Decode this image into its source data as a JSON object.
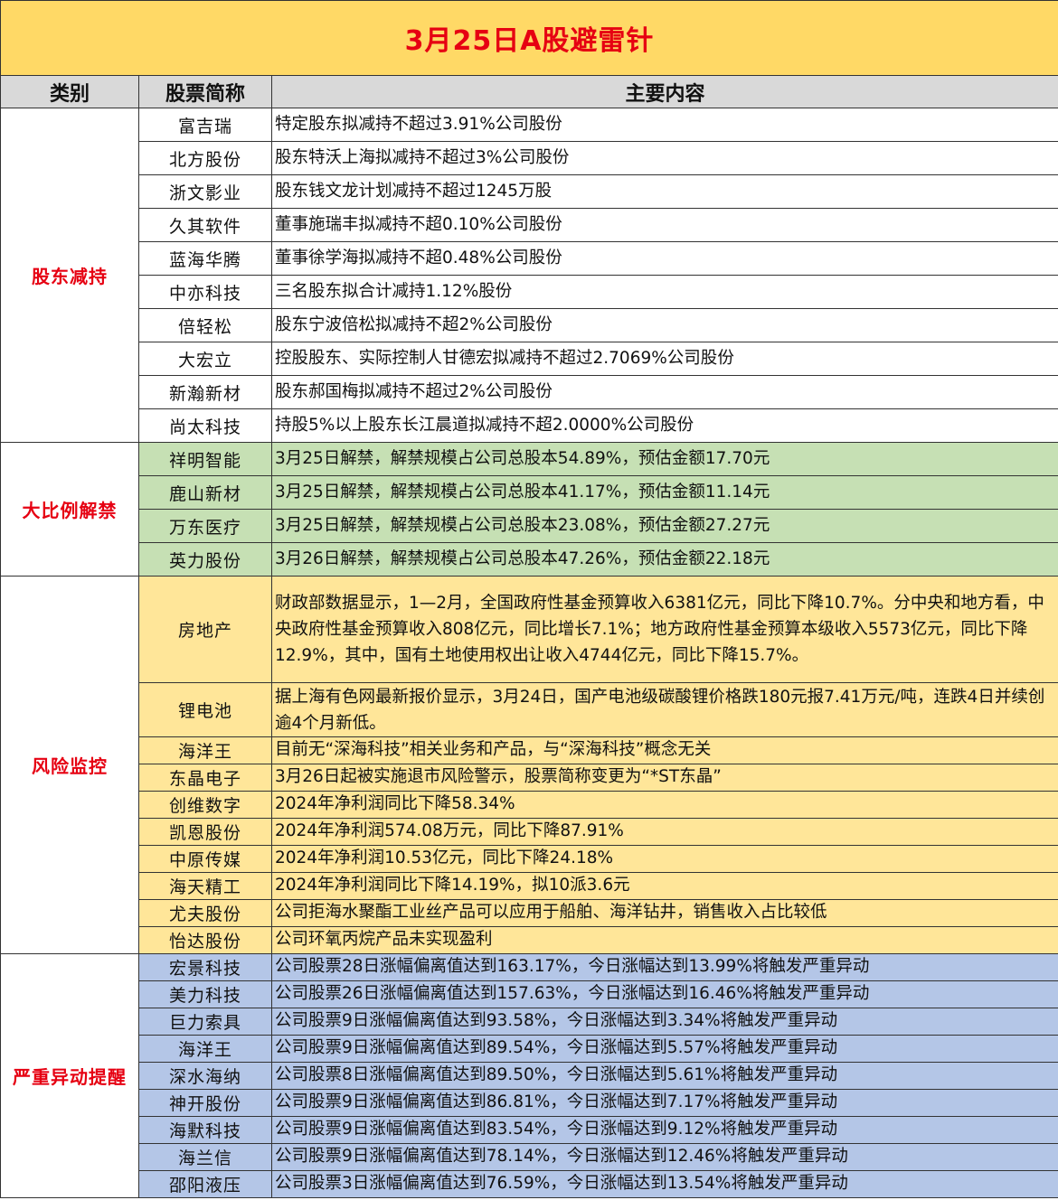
{
  "title": "3月25日A股避雷针",
  "headers": {
    "category": "类别",
    "stock": "股票简称",
    "content": "主要内容"
  },
  "groups": [
    {
      "category": "股东减持",
      "rows": [
        {
          "stock": "富吉瑞",
          "content": "特定股东拟减持不超过3.91%公司股份"
        },
        {
          "stock": "北方股份",
          "content": "股东特沃上海拟减持不超过3%公司股份"
        },
        {
          "stock": "浙文影业",
          "content": "股东钱文龙计划减持不超过1245万股"
        },
        {
          "stock": "久其软件",
          "content": "董事施瑞丰拟减持不超0.10%公司股份"
        },
        {
          "stock": "蓝海华腾",
          "content": "董事徐学海拟减持不超0.48%公司股份"
        },
        {
          "stock": "中亦科技",
          "content": "三名股东拟合计减持1.12%股份"
        },
        {
          "stock": "倍轻松",
          "content": "股东宁波倍松拟减持不超2%公司股份"
        },
        {
          "stock": "大宏立",
          "content": "控股股东、实际控制人甘德宏拟减持不超过2.7069%公司股份"
        },
        {
          "stock": "新瀚新材",
          "content": "股东郝国梅拟减持不超过2%公司股份"
        },
        {
          "stock": "尚太科技",
          "content": "持股5%以上股东长江晨道拟减持不超2.0000%公司股份"
        }
      ]
    },
    {
      "category": "大比例解禁",
      "rows": [
        {
          "stock": "祥明智能",
          "content": "3月25日解禁，解禁规模占公司总股本54.89%，预估金额17.70元"
        },
        {
          "stock": "鹿山新材",
          "content": "3月25日解禁，解禁规模占公司总股本41.17%，预估金额11.14元"
        },
        {
          "stock": "万东医疗",
          "content": "3月25日解禁，解禁规模占公司总股本23.08%，预估金额27.27元"
        },
        {
          "stock": "英力股份",
          "content": "3月26日解禁，解禁规模占公司总股本47.26%，预估金额22.18元"
        }
      ]
    },
    {
      "category": "风险监控",
      "rows": [
        {
          "stock": "房地产",
          "content": "财政部数据显示，1—2月，全国政府性基金预算收入6381亿元，同比下降10.7%。分中央和地方看，中央政府性基金预算收入808亿元，同比增长7.1%；地方政府性基金预算本级收入5573亿元，同比下降12.9%，其中，国有土地使用权出让收入4744亿元，同比下降15.7%。"
        },
        {
          "stock": "锂电池",
          "content": "据上海有色网最新报价显示，3月24日，国产电池级碳酸锂价格跌180元报7.41万元/吨，连跌4日并续创逾4个月新低。"
        },
        {
          "stock": "海洋王",
          "content": "目前无“深海科技”相关业务和产品，与“深海科技”概念无关"
        },
        {
          "stock": "东晶电子",
          "content": "3月26日起被实施退市风险警示，股票简称变更为“*ST东晶”"
        },
        {
          "stock": "创维数字",
          "content": "2024年净利润同比下降58.34%"
        },
        {
          "stock": "凯恩股份",
          "content": "2024年净利润574.08万元，同比下降87.91%"
        },
        {
          "stock": "中原传媒",
          "content": "2024年净利润10.53亿元，同比下降24.18%"
        },
        {
          "stock": "海天精工",
          "content": "2024年净利润同比下降14.19%，拟10派3.6元"
        },
        {
          "stock": "尤夫股份",
          "content": "公司拒海水聚酯工业丝产品可以应用于船舶、海洋钻井，销售收入占比较低"
        },
        {
          "stock": "怡达股份",
          "content": "公司环氧丙烷产品未实现盈利"
        }
      ]
    },
    {
      "category": "严重异动提醒",
      "rows": [
        {
          "stock": "宏景科技",
          "content": "公司股票28日涨幅偏离值达到163.17%，今日涨幅达到13.99%将触发严重异动"
        },
        {
          "stock": "美力科技",
          "content": "公司股票26日涨幅偏离值达到157.63%，今日涨幅达到16.46%将触发严重异动"
        },
        {
          "stock": "巨力索具",
          "content": "公司股票9日涨幅偏离值达到93.58%，今日涨幅达到3.34%将触发严重异动"
        },
        {
          "stock": "海洋王",
          "content": "公司股票9日涨幅偏离值达到89.54%，今日涨幅达到5.57%将触发严重异动"
        },
        {
          "stock": "深水海纳",
          "content": "公司股票8日涨幅偏离值达到89.50%，今日涨幅达到5.61%将触发严重异动"
        },
        {
          "stock": "神开股份",
          "content": "公司股票9日涨幅偏离值达到86.81%，今日涨幅达到7.17%将触发严重异动"
        },
        {
          "stock": "海默科技",
          "content": "公司股票9日涨幅偏离值达到83.54%，今日涨幅达到9.12%将触发严重异动"
        },
        {
          "stock": "海兰信",
          "content": "公司股票9日涨幅偏离值达到78.14%，今日涨幅达到12.46%将触发严重异动"
        },
        {
          "stock": "邵阳液压",
          "content": "公司股票3日涨幅偏离值达到76.59%，今日涨幅达到13.54%将触发严重异动"
        }
      ]
    }
  ]
}
